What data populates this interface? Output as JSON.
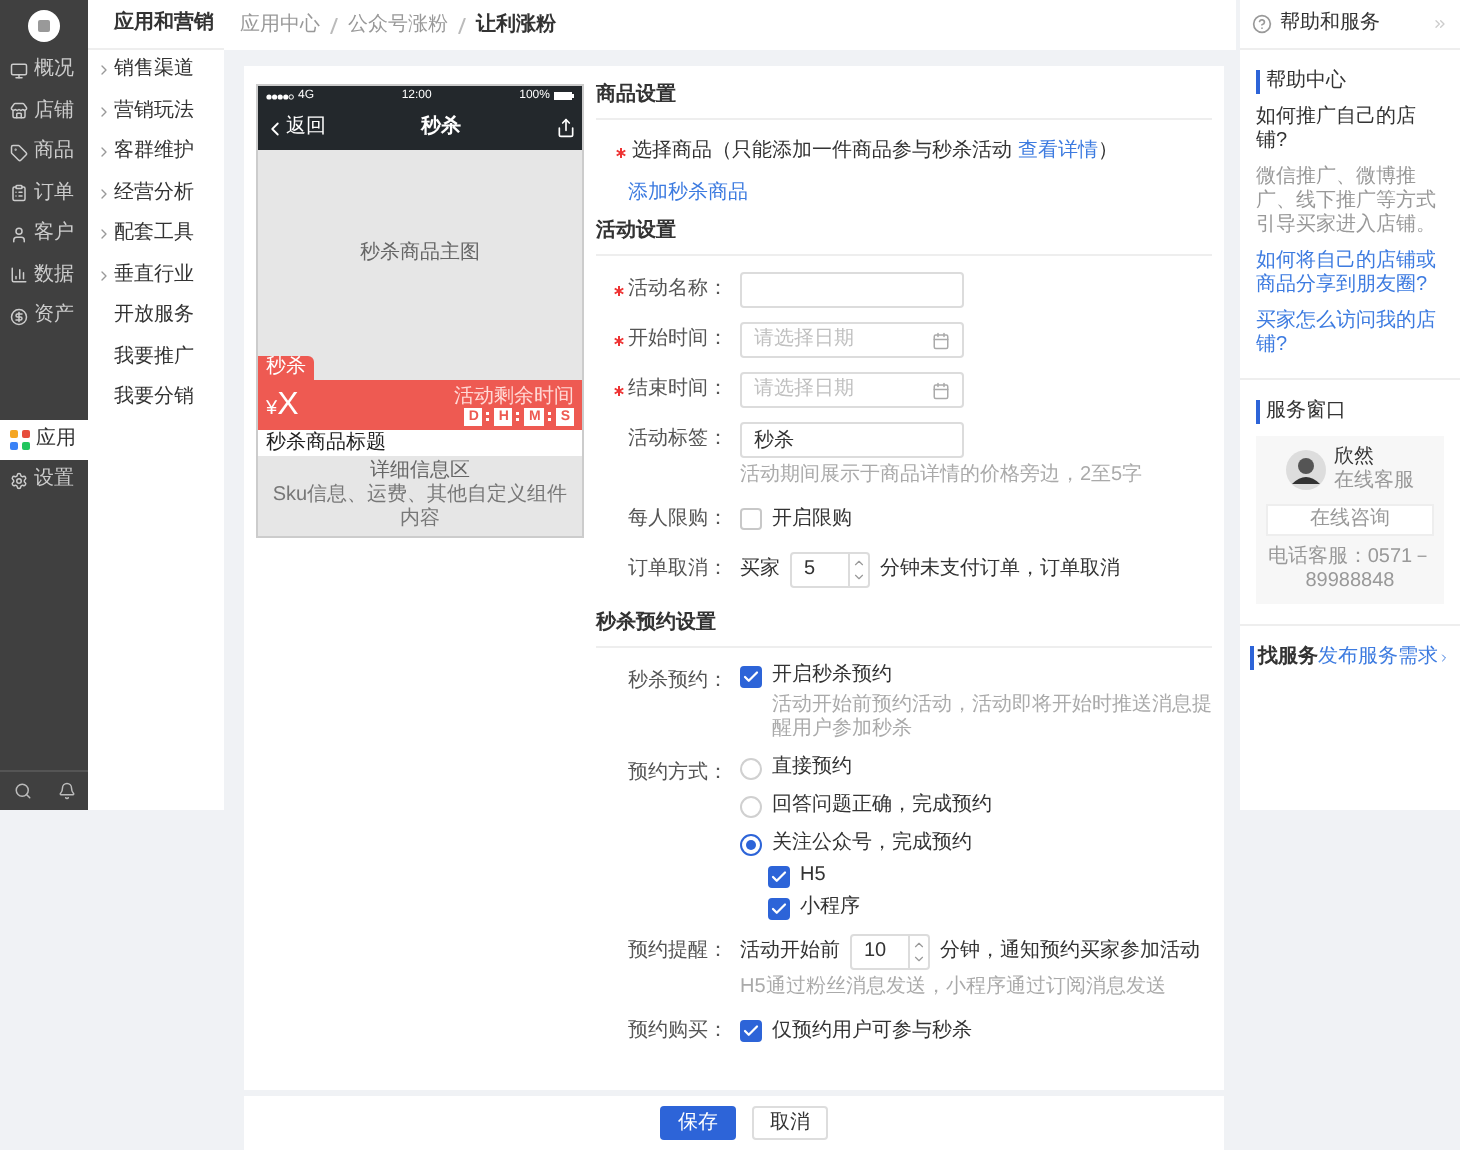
{
  "sidebar": {
    "items": [
      {
        "label": "概况",
        "selected": false
      },
      {
        "label": "店铺",
        "selected": false
      },
      {
        "label": "商品",
        "selected": false
      },
      {
        "label": "订单",
        "selected": false
      },
      {
        "label": "客户",
        "selected": false
      },
      {
        "label": "数据",
        "selected": false
      },
      {
        "label": "资产",
        "selected": false
      },
      {
        "label": "应用",
        "selected": true
      },
      {
        "label": "设置",
        "selected": false
      }
    ]
  },
  "submenu": {
    "title": "应用和营销",
    "items": [
      {
        "label": "销售渠道",
        "expandable": true
      },
      {
        "label": "营销玩法",
        "expandable": true
      },
      {
        "label": "客群维护",
        "expandable": true
      },
      {
        "label": "经营分析",
        "expandable": true
      },
      {
        "label": "配套工具",
        "expandable": true
      },
      {
        "label": "垂直行业",
        "expandable": true
      },
      {
        "label": "开放服务",
        "expandable": false
      },
      {
        "label": "我要推广",
        "expandable": false
      },
      {
        "label": "我要分销",
        "expandable": false
      }
    ]
  },
  "breadcrumb": [
    "应用中心",
    "公众号涨粉",
    "让利涨粉"
  ],
  "preview": {
    "carrier": "4G",
    "time": "12:00",
    "battery": "100%",
    "back": "返回",
    "title": "秒杀",
    "main_image": "秒杀商品主图",
    "tag": "秒杀",
    "currency": "¥",
    "price": "X",
    "countdown_label": "活动剩余时间",
    "countdown": [
      "D",
      "H",
      "M",
      "S"
    ],
    "product_title": "秒杀商品标题",
    "detail_title": "详细信息区",
    "detail_text": "Sku信息、运费、其他自定义组件内容"
  },
  "goods": {
    "title": "商品设置",
    "required": true,
    "select_label": "选择商品（只能添加一件商品参与秒杀活动",
    "select_link": "查看详情",
    "select_suffix": "）",
    "add_link": "添加秒杀商品"
  },
  "activity": {
    "title": "活动设置",
    "fields": [
      {
        "kind": "text",
        "label": "活动名称：",
        "required": true
      },
      {
        "kind": "date",
        "label": "开始时间：",
        "required": true,
        "placeholder": "请选择日期"
      },
      {
        "kind": "date",
        "label": "结束时间：",
        "required": true,
        "placeholder": "请选择日期"
      },
      {
        "kind": "text",
        "label": "活动标签：",
        "required": false,
        "value": "秒杀",
        "hint": "活动期间展示于商品详情的价格旁边，2至5字"
      },
      {
        "kind": "checkbox",
        "label": "每人限购：",
        "required": false,
        "option": "开启限购",
        "checked": false
      },
      {
        "kind": "number",
        "label": "订单取消：",
        "required": false,
        "prefix": "买家",
        "value": "5",
        "suffix": "分钟未支付订单，订单取消"
      }
    ]
  },
  "booking": {
    "title": "秒杀预约设置",
    "fields": [
      {
        "kind": "checkbox",
        "label": "秒杀预约：",
        "required": false,
        "option": "开启秒杀预约",
        "checked": true,
        "hint": "活动开始前预约活动，活动即将开始时推送消息提醒用户参加秒杀"
      },
      {
        "kind": "radio",
        "label": "预约方式：",
        "required": false,
        "options": [
          {
            "label": "直接预约",
            "selected": false
          },
          {
            "label": "回答问题正确，完成预约",
            "selected": false
          },
          {
            "label": "关注公众号，完成预约",
            "selected": true,
            "children": [
              {
                "label": "H5",
                "checked": true
              },
              {
                "label": "小程序",
                "checked": true
              }
            ]
          }
        ]
      },
      {
        "kind": "number",
        "label": "预约提醒：",
        "required": false,
        "prefix": "活动开始前",
        "value": "10",
        "suffix": "分钟，通知预约买家参加活动",
        "hint": "H5通过粉丝消息发送，小程序通过订阅消息发送"
      },
      {
        "kind": "checkbox",
        "label": "预约购买：",
        "required": false,
        "option": "仅预约用户可参与秒杀",
        "checked": true
      }
    ]
  },
  "actions": [
    {
      "label": "保存",
      "kind": "primary"
    },
    {
      "label": "取消",
      "kind": "default"
    }
  ],
  "help": {
    "title": "帮助和服务",
    "center_title": "帮助中心",
    "question": "如何推广自己的店铺?",
    "answer": "微信推广、微博推广、线下推广等方式引导买家进入店铺。",
    "links": [
      "如何将自己的店铺或商品分享到朋友圈?",
      "买家怎么访问我的店铺?"
    ],
    "service_title": "服务窗口",
    "agent_name": "欣然",
    "agent_role": "在线客服",
    "consult_button": "在线咨询",
    "phone": "电话客服：0571－89988848",
    "find_title": "找服务",
    "find_link": "发布服务需求"
  }
}
